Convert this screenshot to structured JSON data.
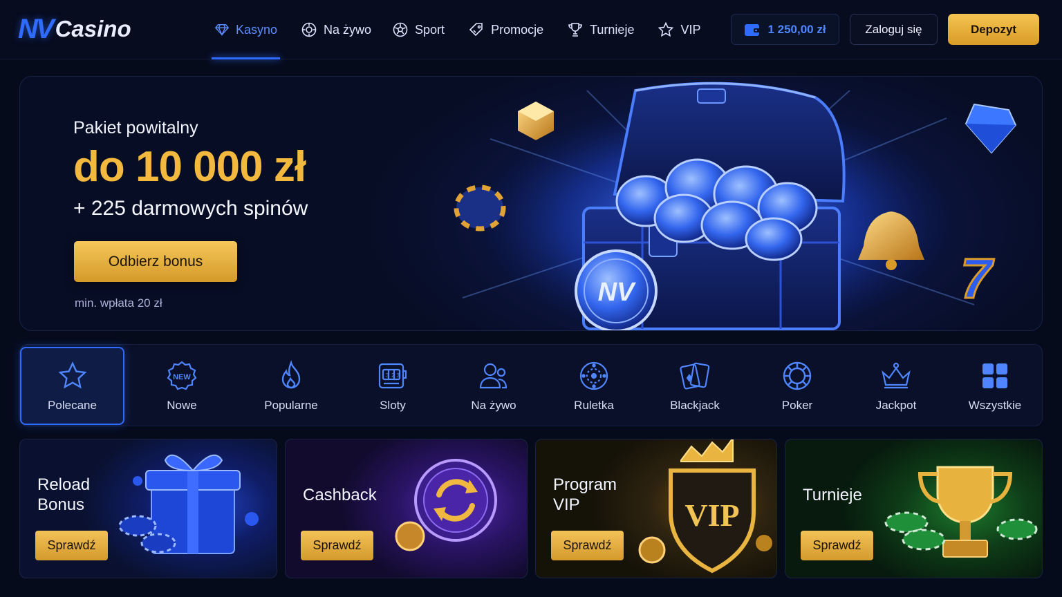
{
  "brand": {
    "logo_mark": "NV",
    "logo_text": "Casino"
  },
  "nav": [
    {
      "label": "Kasyno",
      "icon": "diamond-icon",
      "active": true
    },
    {
      "label": "Na żywo",
      "icon": "live-chip-icon",
      "active": false
    },
    {
      "label": "Sport",
      "icon": "soccer-ball-icon",
      "active": false
    },
    {
      "label": "Promocje",
      "icon": "tag-icon",
      "active": false
    },
    {
      "label": "Turnieje",
      "icon": "trophy-icon",
      "active": false
    },
    {
      "label": "VIP",
      "icon": "star-icon",
      "active": false
    }
  ],
  "header": {
    "balance": "1 250,00 zł",
    "login_label": "Zaloguj się",
    "deposit_label": "Depozyt"
  },
  "hero": {
    "subtitle": "Pakiet powitalny",
    "amount": "do 10 000 zł",
    "spins": "+ 225 darmowych spinów",
    "cta": "Odbierz bonus",
    "note": "min. wpłata 20 zł",
    "coin_mark": "NV"
  },
  "categories": [
    {
      "label": "Polecane",
      "icon": "star-icon",
      "active": true
    },
    {
      "label": "Nowe",
      "icon": "new-badge-icon",
      "badge_text": "NEW"
    },
    {
      "label": "Popularne",
      "icon": "flame-icon"
    },
    {
      "label": "Sloty",
      "icon": "slot-machine-icon"
    },
    {
      "label": "Na żywo",
      "icon": "live-dealer-icon"
    },
    {
      "label": "Ruletka",
      "icon": "roulette-icon"
    },
    {
      "label": "Blackjack",
      "icon": "cards-icon"
    },
    {
      "label": "Poker",
      "icon": "poker-chip-icon"
    },
    {
      "label": "Jackpot",
      "icon": "crown-icon"
    },
    {
      "label": "Wszystkie",
      "icon": "grid-icon"
    }
  ],
  "promos": [
    {
      "title": "Reload\nBonus",
      "button": "Sprawdź",
      "art": "gift-box"
    },
    {
      "title": "Cashback",
      "button": "Sprawdź",
      "art": "cashback-coin"
    },
    {
      "title": "Program\nVIP",
      "button": "Sprawdź",
      "art": "vip-shield",
      "badge_text": "VIP"
    },
    {
      "title": "Turnieje",
      "button": "Sprawdź",
      "art": "trophy"
    }
  ],
  "colors": {
    "accent_blue": "#2f6bff",
    "gold": "#f3b93f",
    "background": "#060b1c"
  }
}
